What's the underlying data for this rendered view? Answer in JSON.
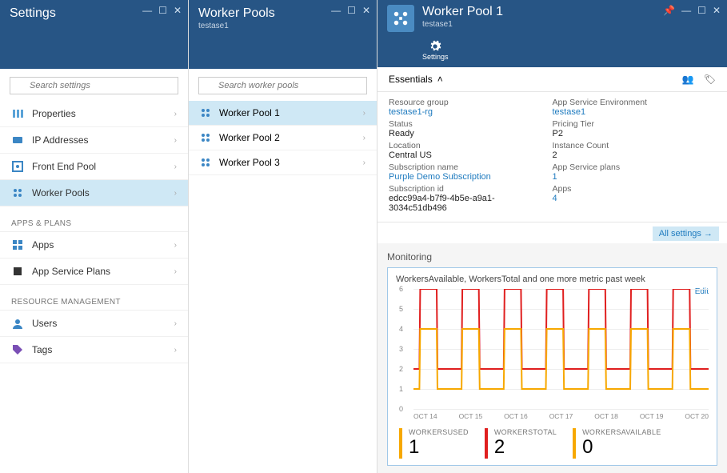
{
  "blade1": {
    "title": "Settings",
    "search_placeholder": "Search settings",
    "groups": [
      {
        "header": null,
        "items": [
          {
            "icon": "properties",
            "label": "Properties",
            "selected": false
          },
          {
            "icon": "ip",
            "label": "IP Addresses",
            "selected": false
          },
          {
            "icon": "frontend",
            "label": "Front End Pool",
            "selected": false
          },
          {
            "icon": "worker",
            "label": "Worker Pools",
            "selected": true
          }
        ]
      },
      {
        "header": "APPS & PLANS",
        "items": [
          {
            "icon": "apps",
            "label": "Apps",
            "selected": false
          },
          {
            "icon": "plans",
            "label": "App Service Plans",
            "selected": false
          }
        ]
      },
      {
        "header": "RESOURCE MANAGEMENT",
        "items": [
          {
            "icon": "users",
            "label": "Users",
            "selected": false
          },
          {
            "icon": "tags",
            "label": "Tags",
            "selected": false
          }
        ]
      }
    ]
  },
  "blade2": {
    "title": "Worker Pools",
    "subtitle": "testase1",
    "search_placeholder": "Search worker pools",
    "items": [
      {
        "label": "Worker Pool 1",
        "selected": true
      },
      {
        "label": "Worker Pool 2",
        "selected": false
      },
      {
        "label": "Worker Pool 3",
        "selected": false
      }
    ]
  },
  "blade3": {
    "title": "Worker Pool 1",
    "subtitle": "testase1",
    "commands": [
      {
        "id": "settings",
        "label": "Settings"
      }
    ],
    "essentials_label": "Essentials",
    "essentials": {
      "left": [
        {
          "label": "Resource group",
          "value": "testase1-rg",
          "link": true
        },
        {
          "label": "Status",
          "value": "Ready",
          "link": false
        },
        {
          "label": "Location",
          "value": "Central US",
          "link": false
        },
        {
          "label": "Subscription name",
          "value": "Purple Demo Subscription",
          "link": true
        },
        {
          "label": "Subscription id",
          "value": "edcc99a4-b7f9-4b5e-a9a1-3034c51db496",
          "link": false
        }
      ],
      "right": [
        {
          "label": "App Service Environment",
          "value": "testase1",
          "link": true
        },
        {
          "label": "Pricing Tier",
          "value": "P2",
          "link": false
        },
        {
          "label": "Instance Count",
          "value": "2",
          "link": false
        },
        {
          "label": "App Service plans",
          "value": "1",
          "link": true
        },
        {
          "label": "Apps",
          "value": "4",
          "link": true
        }
      ]
    },
    "all_settings": "All settings",
    "monitoring_label": "Monitoring",
    "chart_desc": "WorkersAvailable, WorkersTotal and one more metric past week",
    "edit_label": "Edit",
    "counters": [
      {
        "label": "WORKERSUSED",
        "value": "1",
        "color": "#f7a800"
      },
      {
        "label": "WORKERSTOTAL",
        "value": "2",
        "color": "#e01f1f"
      },
      {
        "label": "WORKERSAVAILABLE",
        "value": "0",
        "color": "#f7a800"
      }
    ]
  },
  "chart_data": {
    "type": "line",
    "title": "WorkersAvailable, WorkersTotal and one more metric past week",
    "ylim": [
      0,
      6
    ],
    "y_ticks": [
      0,
      1,
      2,
      3,
      4,
      5,
      6
    ],
    "categories": [
      "OCT 14",
      "OCT 15",
      "OCT 16",
      "OCT 17",
      "OCT 18",
      "OCT 19",
      "OCT 20"
    ],
    "series": [
      {
        "name": "WorkersTotal",
        "color": "#e01f1f",
        "low": 2,
        "high": 6
      },
      {
        "name": "WorkersAvailable",
        "color": "#f7a800",
        "low": 1,
        "high": 4
      }
    ],
    "pattern_per_day_x": [
      0.0,
      0.14,
      0.16,
      0.55,
      0.57,
      0.98,
      1.0
    ],
    "pattern_per_day_y_idx": [
      "low",
      "low",
      "high",
      "high",
      "low",
      "low",
      "low"
    ]
  },
  "icons": {
    "properties": "#5aa3d8",
    "ip": "#3b86c4",
    "frontend": "#3b86c4",
    "worker": "#3b86c4",
    "apps": "#3b86c4",
    "plans": "#333",
    "users": "#3b86c4",
    "tags": "#7a4fb5"
  }
}
